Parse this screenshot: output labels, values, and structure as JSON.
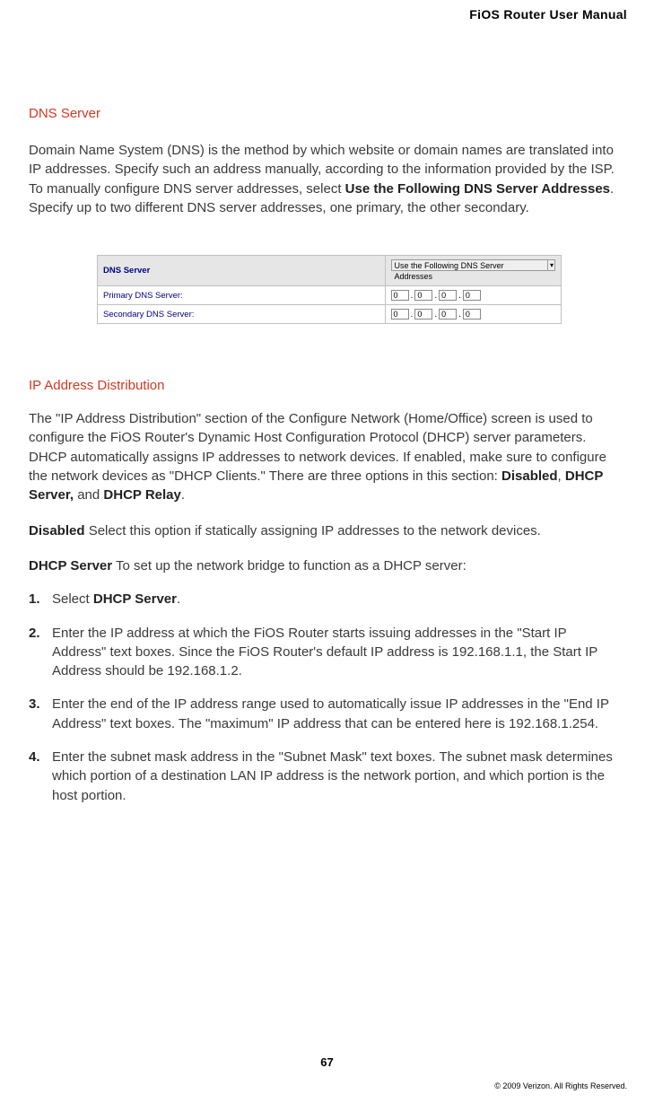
{
  "header": {
    "manual_title": "FiOS Router User Manual"
  },
  "dns_section": {
    "heading": "DNS Server",
    "para1_a": "Domain Name System (DNS) is the method by which website or domain names are translated into IP addresses. Specify such an address manually, according to the information provided by the ISP.",
    "para2_a": "To manually configure DNS server addresses, select ",
    "para2_bold": "Use the Following DNS Server Addresses",
    "para2_b": ". Specify up to two different DNS server addresses, one primary, the other secondary.",
    "table": {
      "hdr_label": "DNS Server",
      "hdr_select": "Use the Following DNS Server Addresses",
      "row1_label": "Primary DNS Server:",
      "row2_label": "Secondary DNS Server:",
      "ip_row1": [
        "0",
        "0",
        "0",
        "0"
      ],
      "ip_row2": [
        "0",
        "0",
        "0",
        "0"
      ]
    }
  },
  "ipd_section": {
    "heading": "IP Address Distribution",
    "para_a": "The \"IP Address Distribution\" section of the Configure Network (Home/Office) screen is used to configure the FiOS Router's Dynamic Host Configuration Protocol (DHCP) server parameters. DHCP automatically assigns IP addresses to network devices. If enabled, make sure to configure the network devices as \"DHCP Clients.\" There are three options in this section: ",
    "para_b1": "Disabled",
    "para_sep1": ", ",
    "para_b2": "DHCP Server,",
    "para_sep2": " and ",
    "para_b3": "DHCP Relay",
    "para_end": ".",
    "disabled_label": "Disabled",
    "disabled_text": "  Select this option if statically assigning IP addresses to the network devices.",
    "dhcp_label": "DHCP Server",
    "dhcp_text": "  To set up the network bridge to function as a DHCP server:",
    "steps": [
      {
        "num": "1.",
        "pre": "Select ",
        "bold": "DHCP Server",
        "post": "."
      },
      {
        "num": "2.",
        "text": "Enter the IP address at which the FiOS Router starts issuing addresses in the \"Start IP Address\" text boxes. Since the FiOS Router's default IP address is 192.168.1.1, the Start IP Address should be 192.168.1.2."
      },
      {
        "num": "3.",
        "text": "Enter the end of the IP address range used to automatically issue IP addresses in the \"End IP Address\" text boxes. The \"maximum\" IP address that can be entered here is 192.168.1.254."
      },
      {
        "num": "4.",
        "text": "Enter the subnet mask address in the \"Subnet Mask\" text boxes. The subnet mask determines which portion of a destination LAN IP address is the network portion, and which portion is the host portion."
      }
    ]
  },
  "footer": {
    "page": "67",
    "copyright": "© 2009 Verizon. All Rights Reserved."
  }
}
